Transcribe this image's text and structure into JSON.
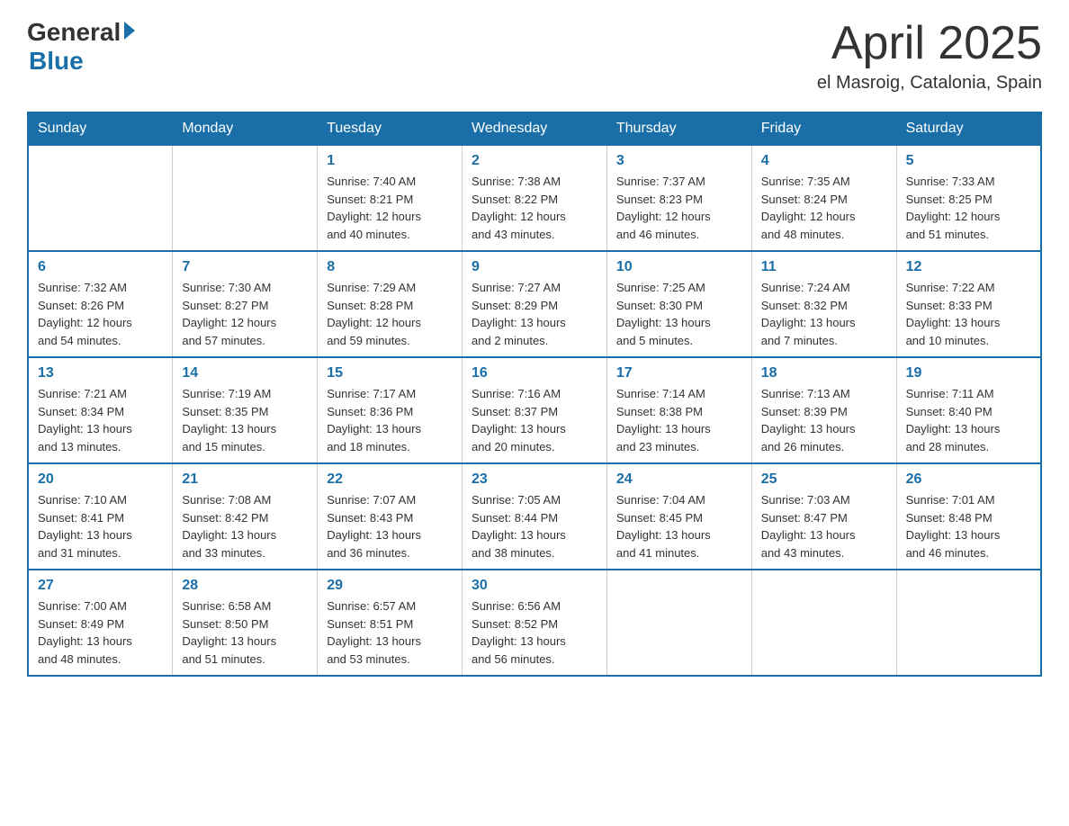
{
  "header": {
    "logo_general": "General",
    "logo_blue": "Blue",
    "month_year": "April 2025",
    "location": "el Masroig, Catalonia, Spain"
  },
  "days_of_week": [
    "Sunday",
    "Monday",
    "Tuesday",
    "Wednesday",
    "Thursday",
    "Friday",
    "Saturday"
  ],
  "weeks": [
    [
      {
        "day": "",
        "info": ""
      },
      {
        "day": "",
        "info": ""
      },
      {
        "day": "1",
        "info": "Sunrise: 7:40 AM\nSunset: 8:21 PM\nDaylight: 12 hours\nand 40 minutes."
      },
      {
        "day": "2",
        "info": "Sunrise: 7:38 AM\nSunset: 8:22 PM\nDaylight: 12 hours\nand 43 minutes."
      },
      {
        "day": "3",
        "info": "Sunrise: 7:37 AM\nSunset: 8:23 PM\nDaylight: 12 hours\nand 46 minutes."
      },
      {
        "day": "4",
        "info": "Sunrise: 7:35 AM\nSunset: 8:24 PM\nDaylight: 12 hours\nand 48 minutes."
      },
      {
        "day": "5",
        "info": "Sunrise: 7:33 AM\nSunset: 8:25 PM\nDaylight: 12 hours\nand 51 minutes."
      }
    ],
    [
      {
        "day": "6",
        "info": "Sunrise: 7:32 AM\nSunset: 8:26 PM\nDaylight: 12 hours\nand 54 minutes."
      },
      {
        "day": "7",
        "info": "Sunrise: 7:30 AM\nSunset: 8:27 PM\nDaylight: 12 hours\nand 57 minutes."
      },
      {
        "day": "8",
        "info": "Sunrise: 7:29 AM\nSunset: 8:28 PM\nDaylight: 12 hours\nand 59 minutes."
      },
      {
        "day": "9",
        "info": "Sunrise: 7:27 AM\nSunset: 8:29 PM\nDaylight: 13 hours\nand 2 minutes."
      },
      {
        "day": "10",
        "info": "Sunrise: 7:25 AM\nSunset: 8:30 PM\nDaylight: 13 hours\nand 5 minutes."
      },
      {
        "day": "11",
        "info": "Sunrise: 7:24 AM\nSunset: 8:32 PM\nDaylight: 13 hours\nand 7 minutes."
      },
      {
        "day": "12",
        "info": "Sunrise: 7:22 AM\nSunset: 8:33 PM\nDaylight: 13 hours\nand 10 minutes."
      }
    ],
    [
      {
        "day": "13",
        "info": "Sunrise: 7:21 AM\nSunset: 8:34 PM\nDaylight: 13 hours\nand 13 minutes."
      },
      {
        "day": "14",
        "info": "Sunrise: 7:19 AM\nSunset: 8:35 PM\nDaylight: 13 hours\nand 15 minutes."
      },
      {
        "day": "15",
        "info": "Sunrise: 7:17 AM\nSunset: 8:36 PM\nDaylight: 13 hours\nand 18 minutes."
      },
      {
        "day": "16",
        "info": "Sunrise: 7:16 AM\nSunset: 8:37 PM\nDaylight: 13 hours\nand 20 minutes."
      },
      {
        "day": "17",
        "info": "Sunrise: 7:14 AM\nSunset: 8:38 PM\nDaylight: 13 hours\nand 23 minutes."
      },
      {
        "day": "18",
        "info": "Sunrise: 7:13 AM\nSunset: 8:39 PM\nDaylight: 13 hours\nand 26 minutes."
      },
      {
        "day": "19",
        "info": "Sunrise: 7:11 AM\nSunset: 8:40 PM\nDaylight: 13 hours\nand 28 minutes."
      }
    ],
    [
      {
        "day": "20",
        "info": "Sunrise: 7:10 AM\nSunset: 8:41 PM\nDaylight: 13 hours\nand 31 minutes."
      },
      {
        "day": "21",
        "info": "Sunrise: 7:08 AM\nSunset: 8:42 PM\nDaylight: 13 hours\nand 33 minutes."
      },
      {
        "day": "22",
        "info": "Sunrise: 7:07 AM\nSunset: 8:43 PM\nDaylight: 13 hours\nand 36 minutes."
      },
      {
        "day": "23",
        "info": "Sunrise: 7:05 AM\nSunset: 8:44 PM\nDaylight: 13 hours\nand 38 minutes."
      },
      {
        "day": "24",
        "info": "Sunrise: 7:04 AM\nSunset: 8:45 PM\nDaylight: 13 hours\nand 41 minutes."
      },
      {
        "day": "25",
        "info": "Sunrise: 7:03 AM\nSunset: 8:47 PM\nDaylight: 13 hours\nand 43 minutes."
      },
      {
        "day": "26",
        "info": "Sunrise: 7:01 AM\nSunset: 8:48 PM\nDaylight: 13 hours\nand 46 minutes."
      }
    ],
    [
      {
        "day": "27",
        "info": "Sunrise: 7:00 AM\nSunset: 8:49 PM\nDaylight: 13 hours\nand 48 minutes."
      },
      {
        "day": "28",
        "info": "Sunrise: 6:58 AM\nSunset: 8:50 PM\nDaylight: 13 hours\nand 51 minutes."
      },
      {
        "day": "29",
        "info": "Sunrise: 6:57 AM\nSunset: 8:51 PM\nDaylight: 13 hours\nand 53 minutes."
      },
      {
        "day": "30",
        "info": "Sunrise: 6:56 AM\nSunset: 8:52 PM\nDaylight: 13 hours\nand 56 minutes."
      },
      {
        "day": "",
        "info": ""
      },
      {
        "day": "",
        "info": ""
      },
      {
        "day": "",
        "info": ""
      }
    ]
  ]
}
